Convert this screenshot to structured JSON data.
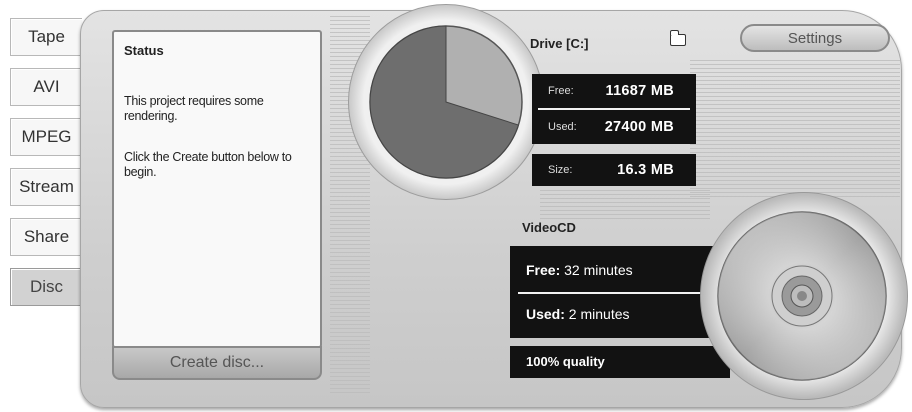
{
  "tabs": [
    {
      "label": "Tape",
      "active": false
    },
    {
      "label": "AVI",
      "active": false
    },
    {
      "label": "MPEG",
      "active": false
    },
    {
      "label": "Stream",
      "active": false
    },
    {
      "label": "Share",
      "active": false
    },
    {
      "label": "Disc",
      "active": true
    }
  ],
  "status": {
    "title": "Status",
    "line1": "This project requires some rendering.",
    "line2": "Click the Create button below to begin."
  },
  "create_button": "Create disc...",
  "drive": {
    "label": "Drive [C:]",
    "free_label": "Free:",
    "free_value": "11687 MB",
    "used_label": "Used:",
    "used_value": "27400 MB",
    "size_label": "Size:",
    "size_value": "16.3 MB",
    "used_fraction": 0.701
  },
  "settings_button": "Settings",
  "videocd": {
    "label": "VideoCD",
    "free_label": "Free:",
    "free_value": "32 minutes",
    "used_label": "Used:",
    "used_value": "2 minutes",
    "quality": "100% quality"
  },
  "icons": {
    "folder": "folder-icon",
    "pie": "disk-usage-pie",
    "disc": "disc-icon"
  },
  "colors": {
    "pie_used": "#6e6e6e",
    "pie_free": "#b0b0b0",
    "panel": "#d4d4d4",
    "readout_bg": "#121212"
  }
}
